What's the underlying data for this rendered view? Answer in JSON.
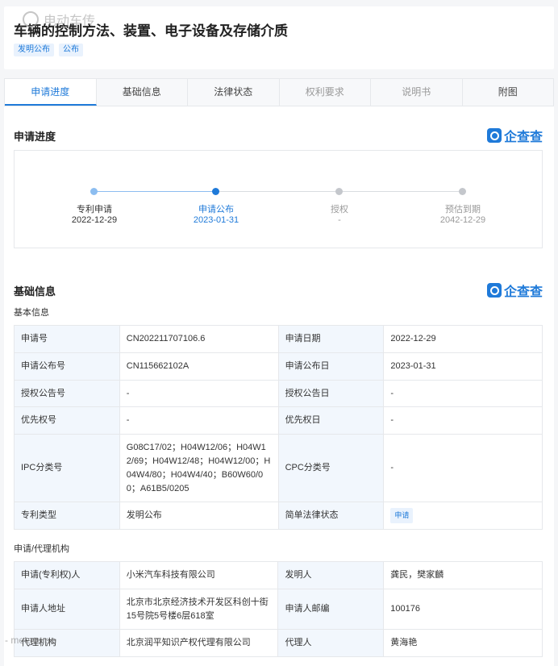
{
  "header": {
    "title": "车辆的控制方法、装置、电子设备及存储介质",
    "tags": [
      "发明公布",
      "公布"
    ],
    "watermark": "电动车传"
  },
  "tabs": [
    {
      "label": "申请进度",
      "state": "active"
    },
    {
      "label": "基础信息",
      "state": "normal"
    },
    {
      "label": "法律状态",
      "state": "normal"
    },
    {
      "label": "权利要求",
      "state": "disabled"
    },
    {
      "label": "说明书",
      "state": "disabled"
    },
    {
      "label": "附图",
      "state": "normal"
    }
  ],
  "progress": {
    "section_title": "申请进度",
    "logo_text": "企查查",
    "steps": [
      {
        "label": "专利申请",
        "date": "2022-12-29",
        "state": "done"
      },
      {
        "label": "申请公布",
        "date": "2023-01-31",
        "state": "current"
      },
      {
        "label": "授权",
        "date": "-",
        "state": "pending"
      },
      {
        "label": "预估到期",
        "date": "2042-12-29",
        "state": "pending"
      }
    ]
  },
  "basic": {
    "section_title": "基础信息",
    "logo_text": "企查查",
    "sub_title": "基本信息",
    "rows": [
      {
        "k1": "申请号",
        "v1": "CN202211707106.6",
        "k2": "申请日期",
        "v2": "2022-12-29"
      },
      {
        "k1": "申请公布号",
        "v1": "CN115662102A",
        "k2": "申请公布日",
        "v2": "2023-01-31"
      },
      {
        "k1": "授权公告号",
        "v1": "-",
        "k2": "授权公告日",
        "v2": "-"
      },
      {
        "k1": "优先权号",
        "v1": "-",
        "k2": "优先权日",
        "v2": "-"
      },
      {
        "k1": "IPC分类号",
        "v1": "G08C17/02；H04W12/06；H04W12/69；H04W12/48；H04W12/00；H04W4/80；H04W4/40；B60W60/00；A61B5/0205",
        "k2": "CPC分类号",
        "v2": "-"
      },
      {
        "k1": "专利类型",
        "v1": "发明公布",
        "k2": "简单法律状态",
        "v2": "申请"
      }
    ]
  },
  "agency": {
    "sub_title": "申请/代理机构",
    "rows": [
      {
        "k1": "申请(专利权)人",
        "v1": "小米汽车科技有限公司",
        "k2": "发明人",
        "v2": "龚民，樊家麟"
      },
      {
        "k1": "申请人地址",
        "v1": "北京市北京经济技术开发区科创十街15号院5号楼6层618室",
        "k2": "申请人邮编",
        "v2": "100176"
      },
      {
        "k1": "代理机构",
        "v1": "北京润平知识产权代理有限公司",
        "k2": "代理人",
        "v2": "黄海艳"
      }
    ]
  },
  "footer_watermark": "- metaverse"
}
